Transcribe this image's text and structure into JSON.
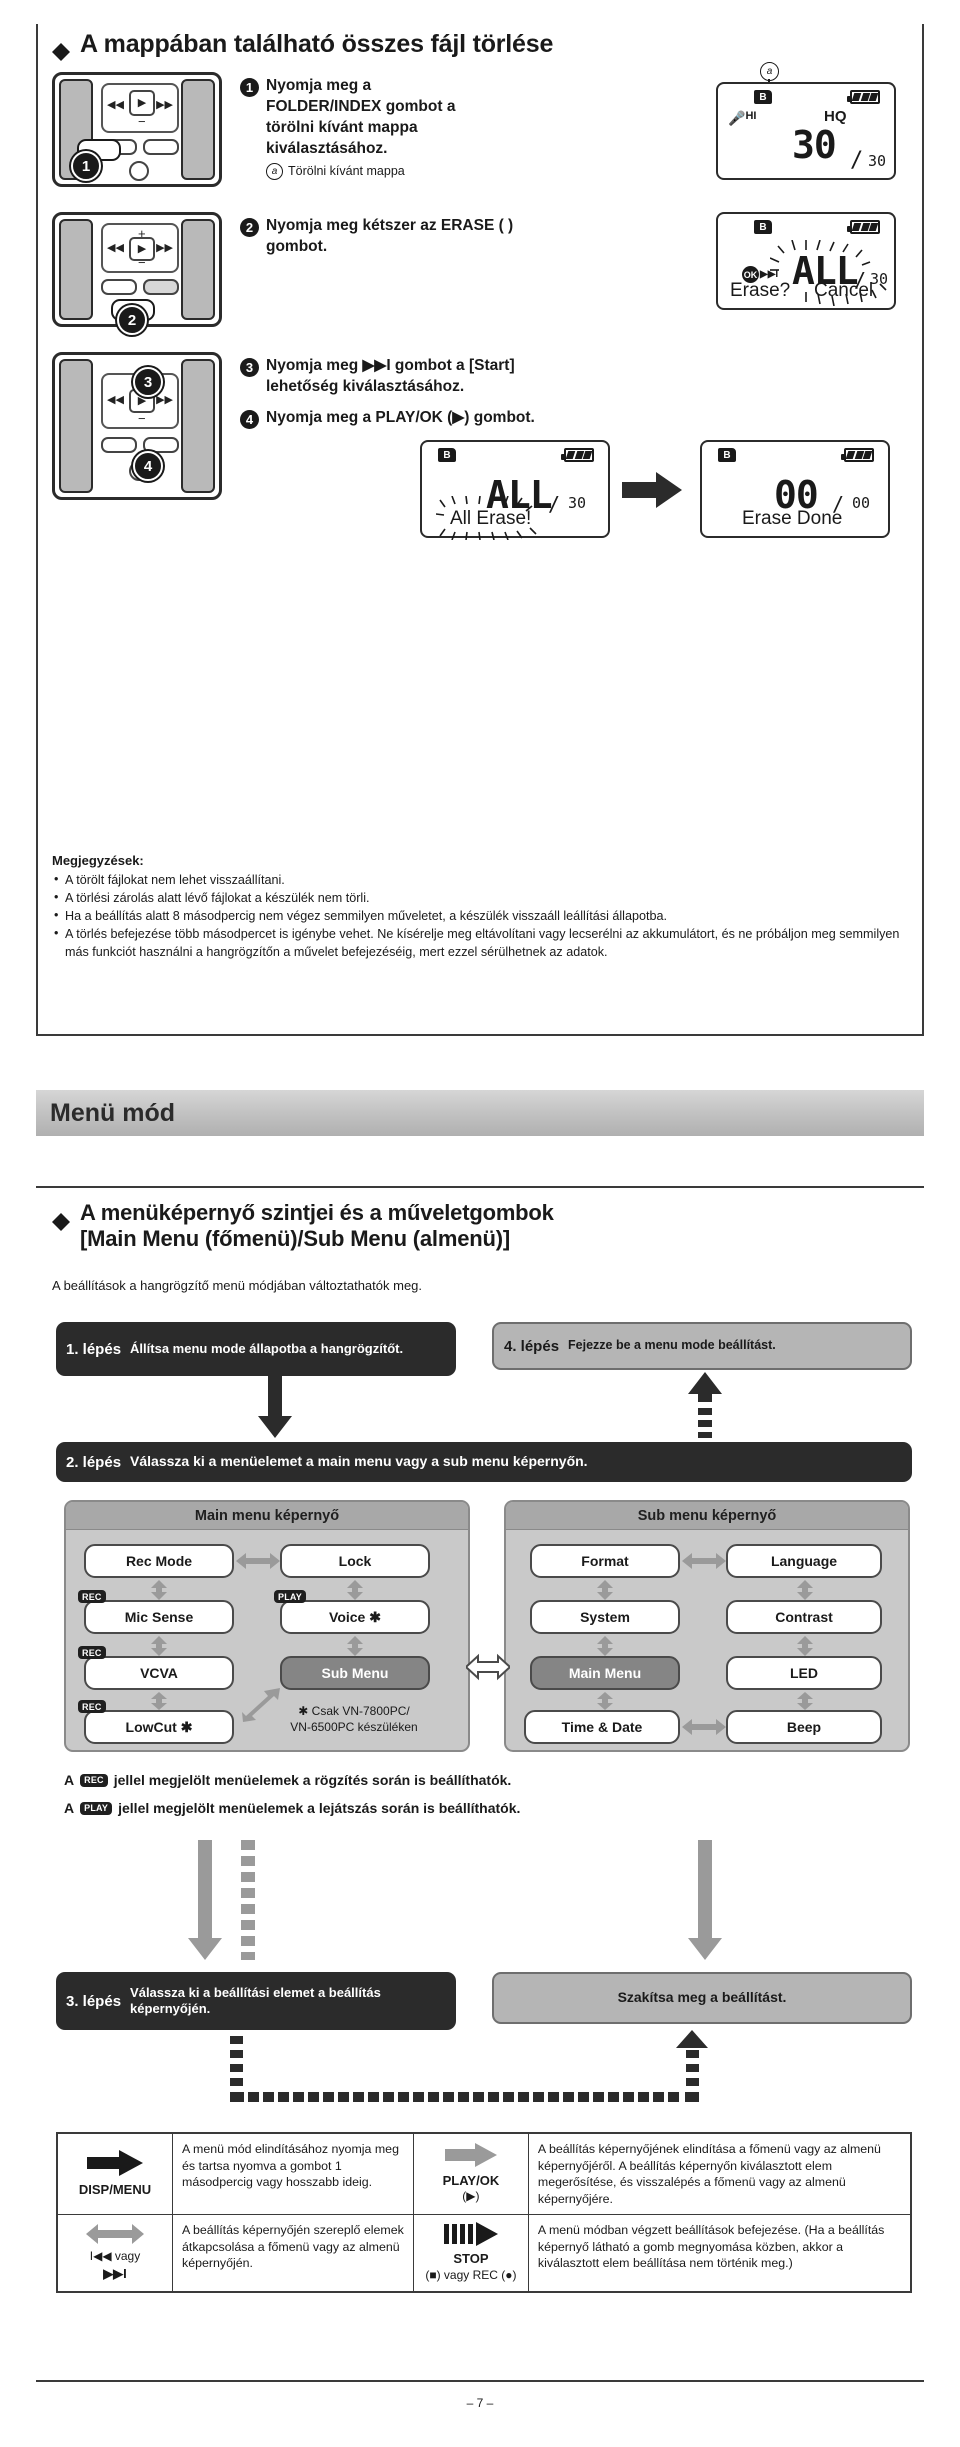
{
  "section1": {
    "heading": "A mappában található összes fájl törlése",
    "steps": [
      {
        "num": "❶",
        "text": "Nyomja meg a FOLDER/INDEX gombot a törölni kívánt mappa kiválasztásához.",
        "lines": [
          "Nyomja meg",
          "a FOLDER/INDEX",
          "gombot a törölni",
          "kívánt mappa",
          "kiválasztásához."
        ],
        "bold_token": "FOLDER/INDEX",
        "subnote_marker": "a",
        "subnote": "Törölni kívánt mappa"
      },
      {
        "num": "❷",
        "text": "Nyomja meg kétszer az ERASE ( ) gombot.",
        "lines": [
          "Nyomja meg kétszer az",
          "ERASE (●) gombot."
        ]
      },
      {
        "num": "❸",
        "text": "Nyomja meg ▶▶I gombot a [Start] lehetőség kiválasztásához.",
        "lines": [
          "Nyomja meg ▶▶I gombot a [Start]",
          "lehetőség kiválasztásához."
        ]
      },
      {
        "num": "❹",
        "text": "Nyomja meg a PLAY/OK (▶) gombot.",
        "lines": [
          "Nyomja meg a PLAY/OK (▶) gombot."
        ]
      }
    ],
    "displays": {
      "d1": {
        "callout": "a",
        "folder": "B",
        "mic": "HI",
        "quality": "HQ",
        "big": "30",
        "slash": "/",
        "small": "30"
      },
      "d2": {
        "folder": "B",
        "big": "ALL",
        "slash": "/",
        "small": "30",
        "ok": "OK",
        "ok_arrow": "▶▶I",
        "left_word": "Erase?",
        "right_word": "Cancel"
      },
      "d3": {
        "folder": "B",
        "big": "ALL",
        "slash": "/",
        "small": "30",
        "word": "All Erase!"
      },
      "d4": {
        "folder": "B",
        "big": "00",
        "slash": "/",
        "small": "00",
        "word": "Erase Done"
      }
    },
    "notes": {
      "title": "Megjegyzések:",
      "items": [
        "A törölt fájlokat nem lehet visszaállítani.",
        "A törlési zárolás alatt lévő fájlokat a készülék nem törli.",
        "Ha a beállítás alatt 8 másodpercig nem végez semmilyen műveletet, a készülék visszaáll leállítási állapotba.",
        "A törlés befejezése több másodpercet is igénybe vehet. Ne kísérelje meg eltávolítani vagy lecserélni az akkumulátort, és ne próbáljon meg semmilyen más funkciót használni a hangrögzítőn a művelet befejezéséig, mert ezzel sérülhetnek az adatok."
      ]
    }
  },
  "menu_mode": {
    "band_title": "Menü mód",
    "heading_line1": "A menüképernyő szintjei és a műveletgombok",
    "heading_line2_pre": "[",
    "heading_line2_a": "Main Menu",
    "heading_line2_b": " (főmenü)/",
    "heading_line2_c": "Sub Menu",
    "heading_line2_d": " (almenü)]",
    "subtitle": "A beállítások a hangrögzítő menü módjában változtathatók meg.",
    "steps": {
      "s1_label": "1. lépés",
      "s1_text": "Állítsa menu mode állapotba a hangrögzítőt.",
      "s2_label": "2. lépés",
      "s2_text": "Válassza ki a menüelemet a main menu vagy a sub menu képernyőn.",
      "s3_label": "3. lépés",
      "s3_text": "Válassza ki a beállítási elemet a beállítás képernyőjén.",
      "s4_label": "4. lépés",
      "s4_text": "Fejezze be a menu mode beállítást.",
      "cancel_text": "Szakítsa meg a beállítást."
    },
    "main_panel": {
      "title": "Main menu képernyő",
      "items": [
        {
          "label": "Rec Mode",
          "tag": "",
          "selected": false
        },
        {
          "label": "Lock",
          "tag": "",
          "selected": false
        },
        {
          "label": "Mic Sense",
          "tag": "REC",
          "selected": false
        },
        {
          "label": "Voice ✱",
          "tag": "PLAY",
          "selected": false
        },
        {
          "label": "VCVA",
          "tag": "REC",
          "selected": false
        },
        {
          "label": "Sub Menu",
          "tag": "",
          "selected": true
        },
        {
          "label": "LowCut ✱",
          "tag": "REC",
          "selected": false
        }
      ],
      "star_note_line1": "✱ Csak VN-7800PC/",
      "star_note_line2": "VN-6500PC készüléken"
    },
    "sub_panel": {
      "title": "Sub menu képernyő",
      "items": [
        {
          "label": "Format",
          "selected": false
        },
        {
          "label": "Language",
          "selected": false
        },
        {
          "label": "System",
          "selected": false
        },
        {
          "label": "Contrast",
          "selected": false
        },
        {
          "label": "Main Menu",
          "selected": true
        },
        {
          "label": "LED",
          "selected": false
        },
        {
          "label": "Time & Date",
          "selected": false
        },
        {
          "label": "Beep",
          "selected": false
        }
      ]
    },
    "legends": [
      {
        "pre": "A",
        "tag": "REC",
        "post": "jellel megjelölt menüelemek a rögzítés során is beállíthatók."
      },
      {
        "pre": "A",
        "tag": "PLAY",
        "post": "jellel megjelölt menüelemek a lejátszás során is beállíthatók."
      }
    ],
    "table": {
      "rows": [
        {
          "left_icon_label": "DISP/MENU",
          "left_icon_sub": "",
          "left_text": "A menü mód elindításához nyomja meg és tartsa nyomva a gombot 1 másodpercig vagy hosszabb ideig.",
          "right_icon_label": "PLAY/OK",
          "right_icon_sub": "(▶)",
          "right_text": "A beállítás képernyőjének elindítása a főmenü vagy az almenü képernyőjéről. A beállítás képernyőn kiválasztott elem megerősítése, és visszalépés a főmenü vagy az almenü képernyőjére."
        },
        {
          "left_icon_label": "I◀◀ vagy",
          "left_icon_sub": "▶▶I",
          "left_text": "A beállítás képernyőjén szereplő elemek átkapcsolása a főmenü vagy az almenü képernyőjén.",
          "right_icon_label": "STOP",
          "right_icon_sub": "(■) vagy REC (●)",
          "right_text": "A menü módban végzett beállítások befejezése. (Ha a beállítás képernyő látható a gomb megnyomása közben, akkor a kiválasztott elem beállítása nem történik meg.)"
        }
      ]
    }
  },
  "footer": {
    "page": "– 7 –"
  },
  "colors": {
    "ink": "#1a1a1a",
    "dark_pill": "#2b2b2b",
    "grey_pill": "#b5b5b5",
    "panel_bg": "#c9c9c9",
    "panel_hdr": "#a8a8a8",
    "selected": "#858585",
    "band": "#c2c2c2",
    "arrow_grey": "#9a9a9a"
  }
}
